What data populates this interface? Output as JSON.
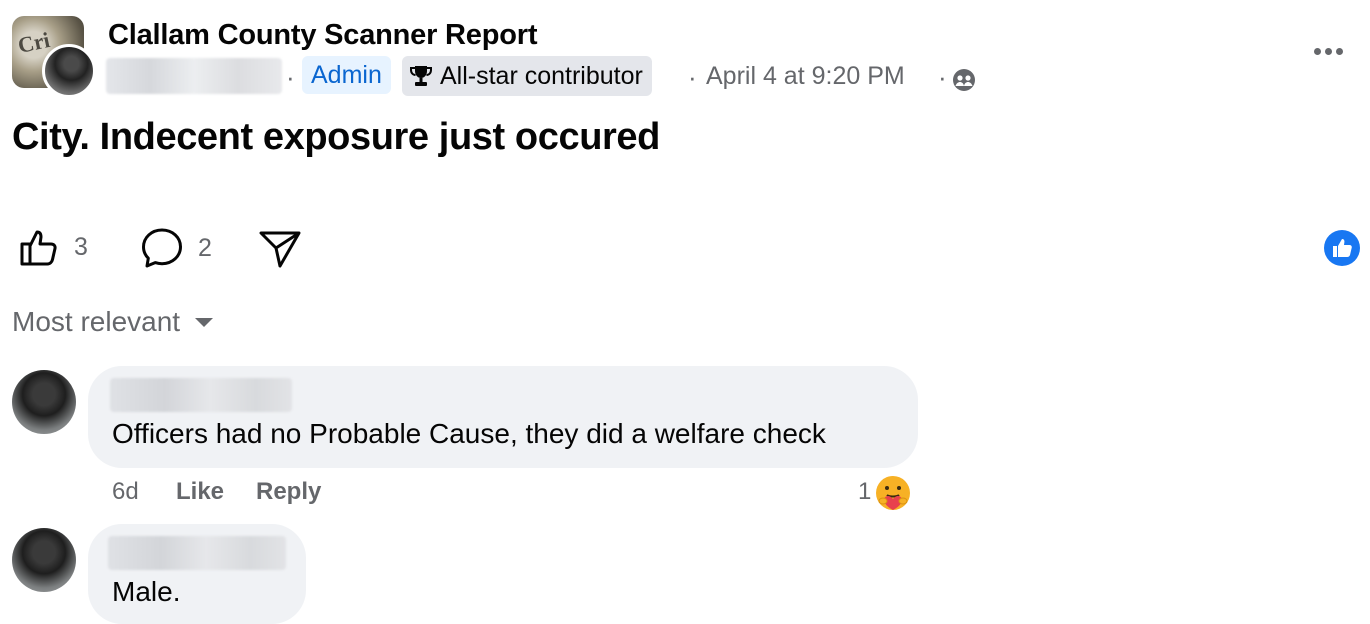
{
  "post": {
    "group_name": "Clallam County Scanner Report",
    "admin_label": "Admin",
    "badge_label": "All-star contributor",
    "time": "April 4 at 9:20 PM",
    "separator": "·",
    "text": "City. Indecent exposure just occured",
    "like_count": "3",
    "comment_count": "2",
    "icons": {
      "badge": "trophy-icon",
      "audience": "group-audience-icon",
      "more": "more-options-icon",
      "like": "thumbs-up-icon",
      "comment": "comment-bubble-icon",
      "share": "share-arrow-icon",
      "reaction": "like-reaction-icon"
    },
    "accent_color": "#1877f2"
  },
  "sort": {
    "label": "Most relevant"
  },
  "comments": [
    {
      "text": "Officers had no Probable Cause, they did a welfare check",
      "time": "6d",
      "like_label": "Like",
      "reply_label": "Reply",
      "reaction_count": "1",
      "reaction_icon": "care-reaction-icon"
    },
    {
      "text": "Male."
    }
  ]
}
